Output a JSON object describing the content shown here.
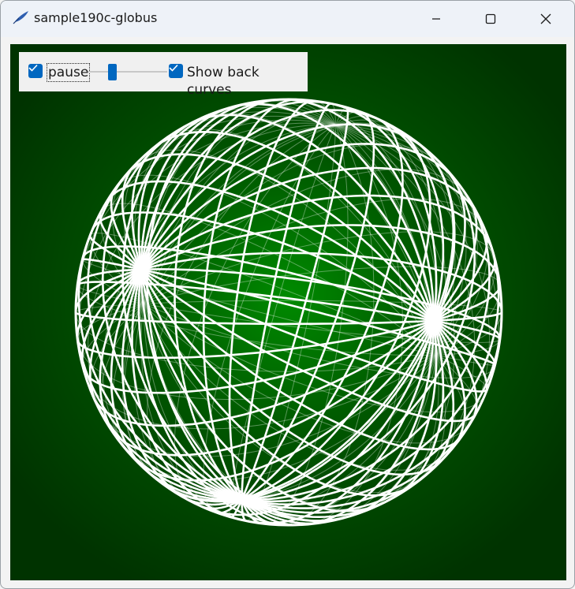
{
  "window": {
    "title": "sample190c-globus",
    "icon": "feather-pen-icon"
  },
  "controls": {
    "pause_label": "pause",
    "pause_checked": true,
    "speed_slider_value": 0.3,
    "back_curves_label": "Show back curves",
    "back_curves_checked": true
  },
  "scene": {
    "background_color": "#003300",
    "sphere_center_color": "#008000",
    "curve_color": "#ffffff"
  }
}
